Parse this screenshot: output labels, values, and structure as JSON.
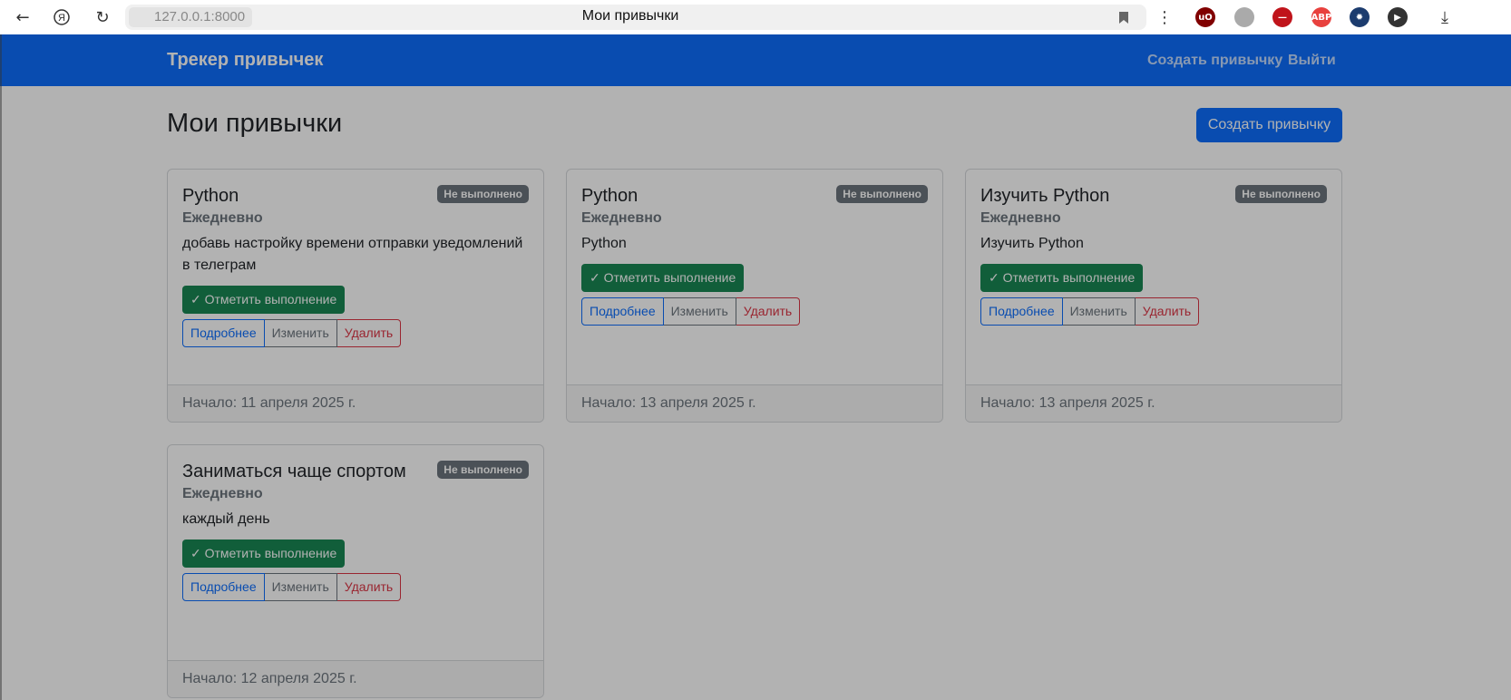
{
  "browser": {
    "url_host": "127.0.0.1:8000",
    "tab_title": "Мои привычки",
    "back_icon": "back-arrow-icon",
    "extensions": [
      {
        "name": "ublock-icon",
        "label": "uO",
        "color": "#800000"
      },
      {
        "name": "extension-gray-icon",
        "label": "",
        "color": "#aaaaaa"
      },
      {
        "name": "adblock-shield-icon",
        "label": "—",
        "color": "#c0141b"
      },
      {
        "name": "abp-icon",
        "label": "ABP",
        "color": "#e8413e"
      },
      {
        "name": "gear-extension-icon",
        "label": "✹",
        "color": "#1c3c6e"
      },
      {
        "name": "media-extension-icon",
        "label": "▶",
        "color": "#333333"
      },
      {
        "name": "puzzle-icon",
        "label": "⧉",
        "color": "#444444"
      }
    ]
  },
  "navbar": {
    "brand": "Трекер привычек",
    "links": [
      "Создать привычку",
      "Выйти"
    ]
  },
  "main": {
    "title": "Мои привычки",
    "create_button": "Создать привычку"
  },
  "cards": [
    {
      "title": "Python",
      "status": "Не выполнено",
      "frequency": "Ежедневно",
      "description": "добавь настройку времени отправки уведомлений в телеграм",
      "mark_button": "✓ Отметить выполнение",
      "details": "Подробнее",
      "edit": "Изменить",
      "delete": "Удалить",
      "footer": "Начало: 11 апреля 2025 г."
    },
    {
      "title": "Python",
      "status": "Не выполнено",
      "frequency": "Ежедневно",
      "description": "Python",
      "mark_button": "✓ Отметить выполнение",
      "details": "Подробнее",
      "edit": "Изменить",
      "delete": "Удалить",
      "footer": "Начало: 13 апреля 2025 г."
    },
    {
      "title": "Изучить Python",
      "status": "Не выполнено",
      "frequency": "Ежедневно",
      "description": "Изучить Python",
      "mark_button": "✓ Отметить выполнение",
      "details": "Подробнее",
      "edit": "Изменить",
      "delete": "Удалить",
      "footer": "Начало: 13 апреля 2025 г."
    },
    {
      "title": "Заниматься чаще спортом",
      "status": "Не выполнено",
      "frequency": "Ежедневно",
      "description": "каждый день",
      "mark_button": "✓ Отметить выполнение",
      "details": "Подробнее",
      "edit": "Изменить",
      "delete": "Удалить",
      "footer": "Начало: 12 апреля 2025 г."
    }
  ]
}
